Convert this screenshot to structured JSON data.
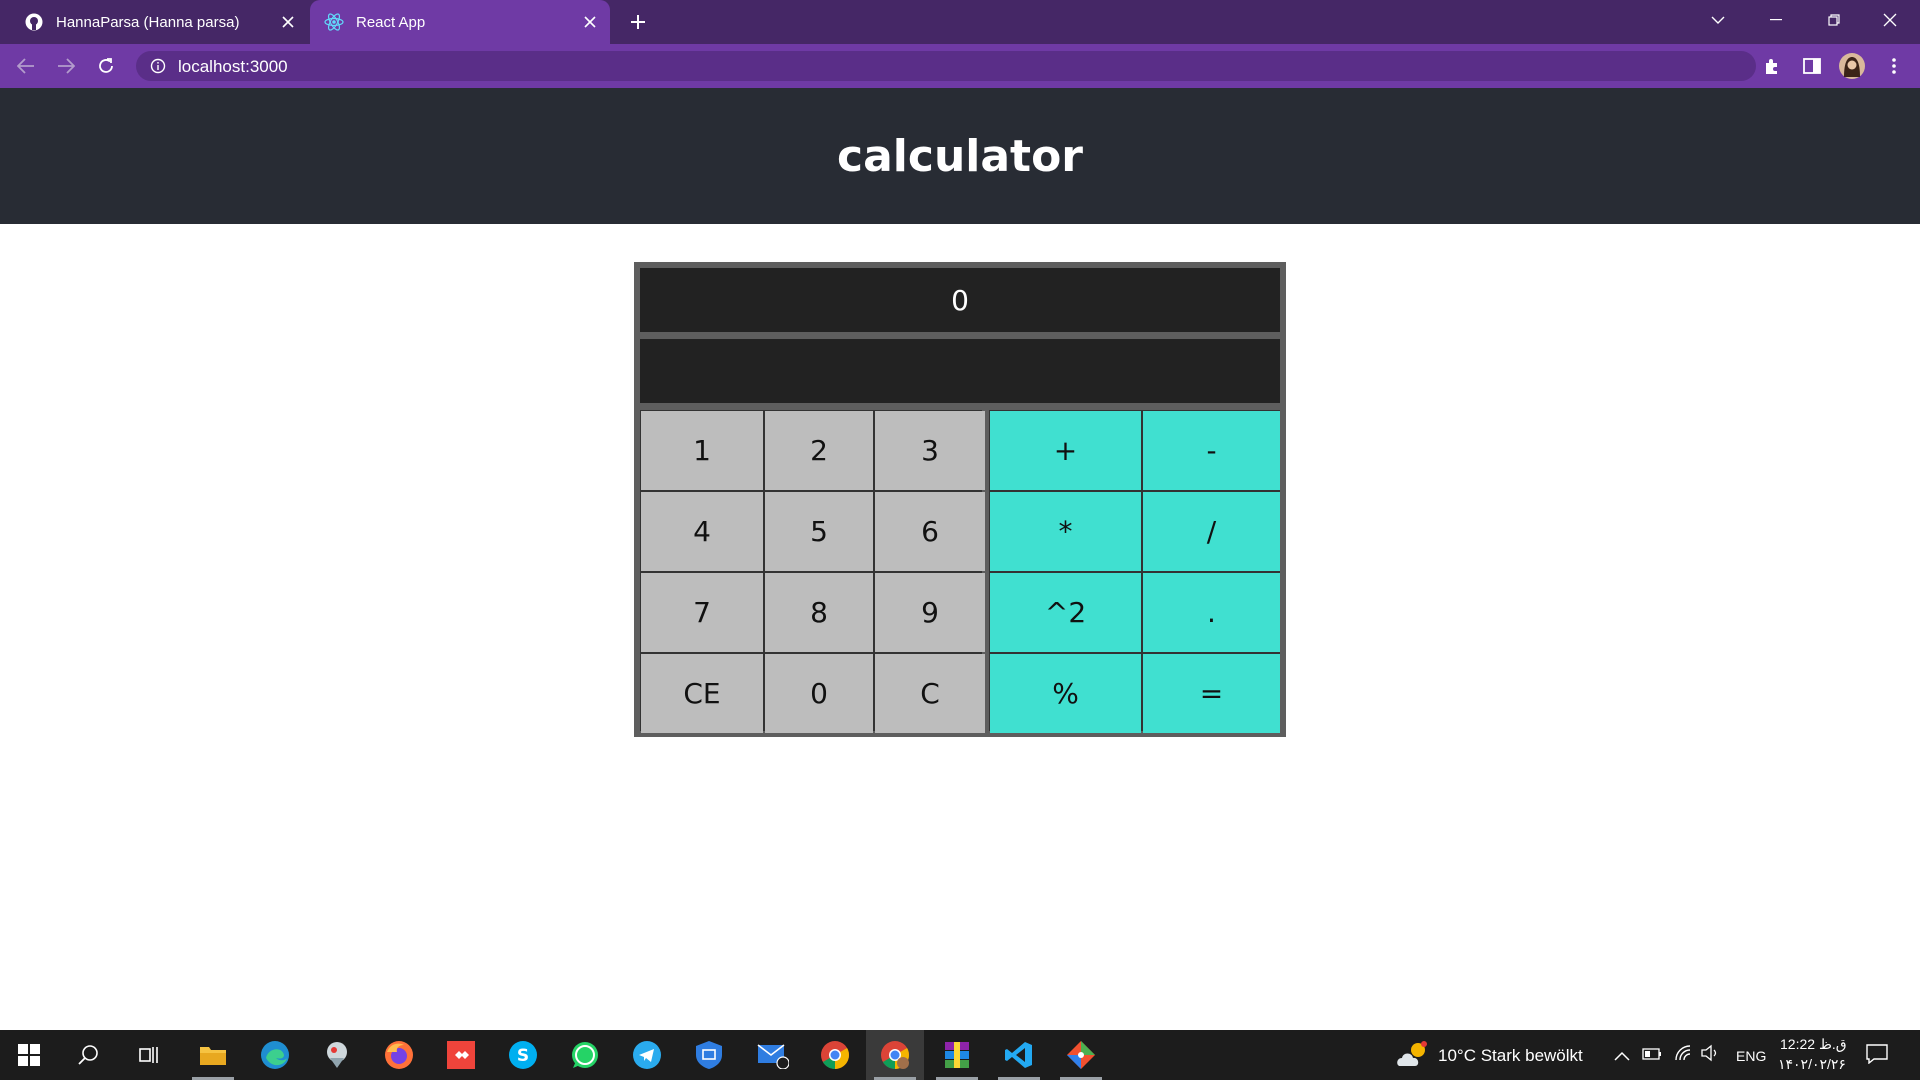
{
  "browser": {
    "tabs": [
      {
        "title": "HannaParsa (Hanna parsa)",
        "icon": "github-icon"
      },
      {
        "title": "React App",
        "icon": "react-icon",
        "active": true
      }
    ],
    "url": "localhost:3000",
    "accent_color": "#6f3aa5",
    "tabstrip_color": "#452766"
  },
  "app": {
    "title": "calculator",
    "header_color": "#282c34"
  },
  "calculator": {
    "display_value": "0",
    "secondary_display": "",
    "number_keys": [
      "1",
      "2",
      "3",
      "4",
      "5",
      "6",
      "7",
      "8",
      "9",
      "CE",
      "0",
      "C"
    ],
    "operator_keys": [
      "+",
      "-",
      "*",
      "/",
      "^2",
      ".",
      "%",
      "="
    ],
    "number_key_color": "#bdbdbd",
    "operator_key_color": "#40e0d0"
  },
  "taskbar": {
    "apps": [
      "start-icon",
      "search-icon",
      "task-view-icon",
      "file-explorer-icon",
      "edge-icon",
      "app-icon",
      "firefox-icon",
      "anydesk-icon",
      "skype-icon",
      "whatsapp-icon",
      "telegram-icon",
      "security-icon",
      "mail-icon",
      "chrome-icon",
      "chrome-profile-icon",
      "winrar-icon",
      "vscode-icon",
      "git-icon"
    ],
    "weather": "10°C  Stark bewölkt",
    "language": "ENG",
    "time": "12:22 ق.ظ",
    "date": "۱۴۰۲/۰۲/۲۶"
  }
}
